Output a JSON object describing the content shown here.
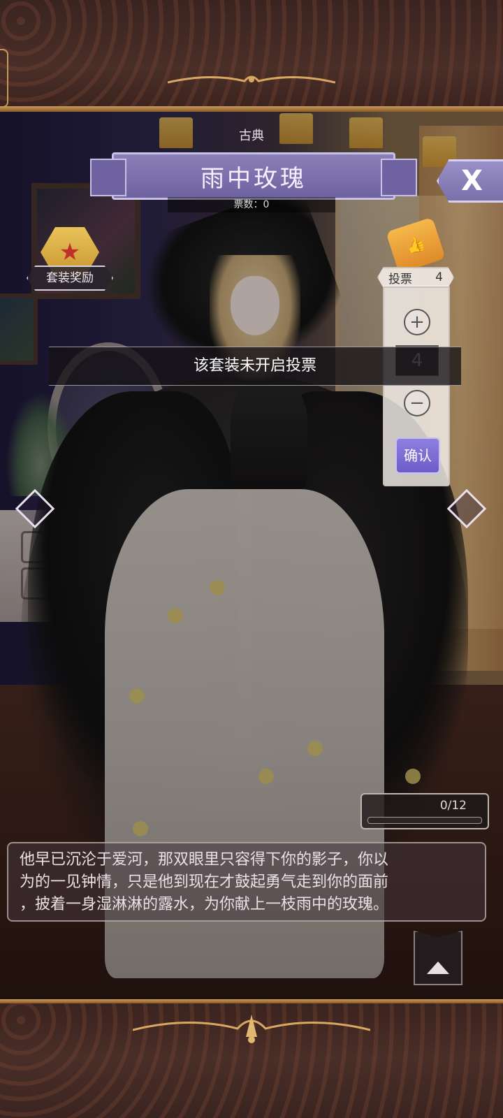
{
  "header": {
    "category": "古典",
    "title": "雨中玫瑰",
    "votes_label": "票数：0",
    "close_label": "X"
  },
  "reward": {
    "label": "套装奖励"
  },
  "vote": {
    "label": "投票",
    "count": "4",
    "input_value": "4",
    "plus_label": "+",
    "minus_label": "−",
    "confirm_label": "确认"
  },
  "toast": {
    "message": "该套装未开启投票"
  },
  "progress": {
    "text": "0/12",
    "value": 0,
    "max": 12
  },
  "description": {
    "line1": "他早已沉沦于爱河，那双眼里只容得下你的影子，你以",
    "line2": "为的一见钟情，只是他到现在才鼓起勇气走到你的面前",
    "line3": "，披着一身湿淋淋的露水，为你献上一枝雨中的玫瑰。"
  },
  "colors": {
    "accent": "#7a70aa",
    "confirm": "#6c5cc8",
    "frame_gold": "#c89a5a"
  }
}
